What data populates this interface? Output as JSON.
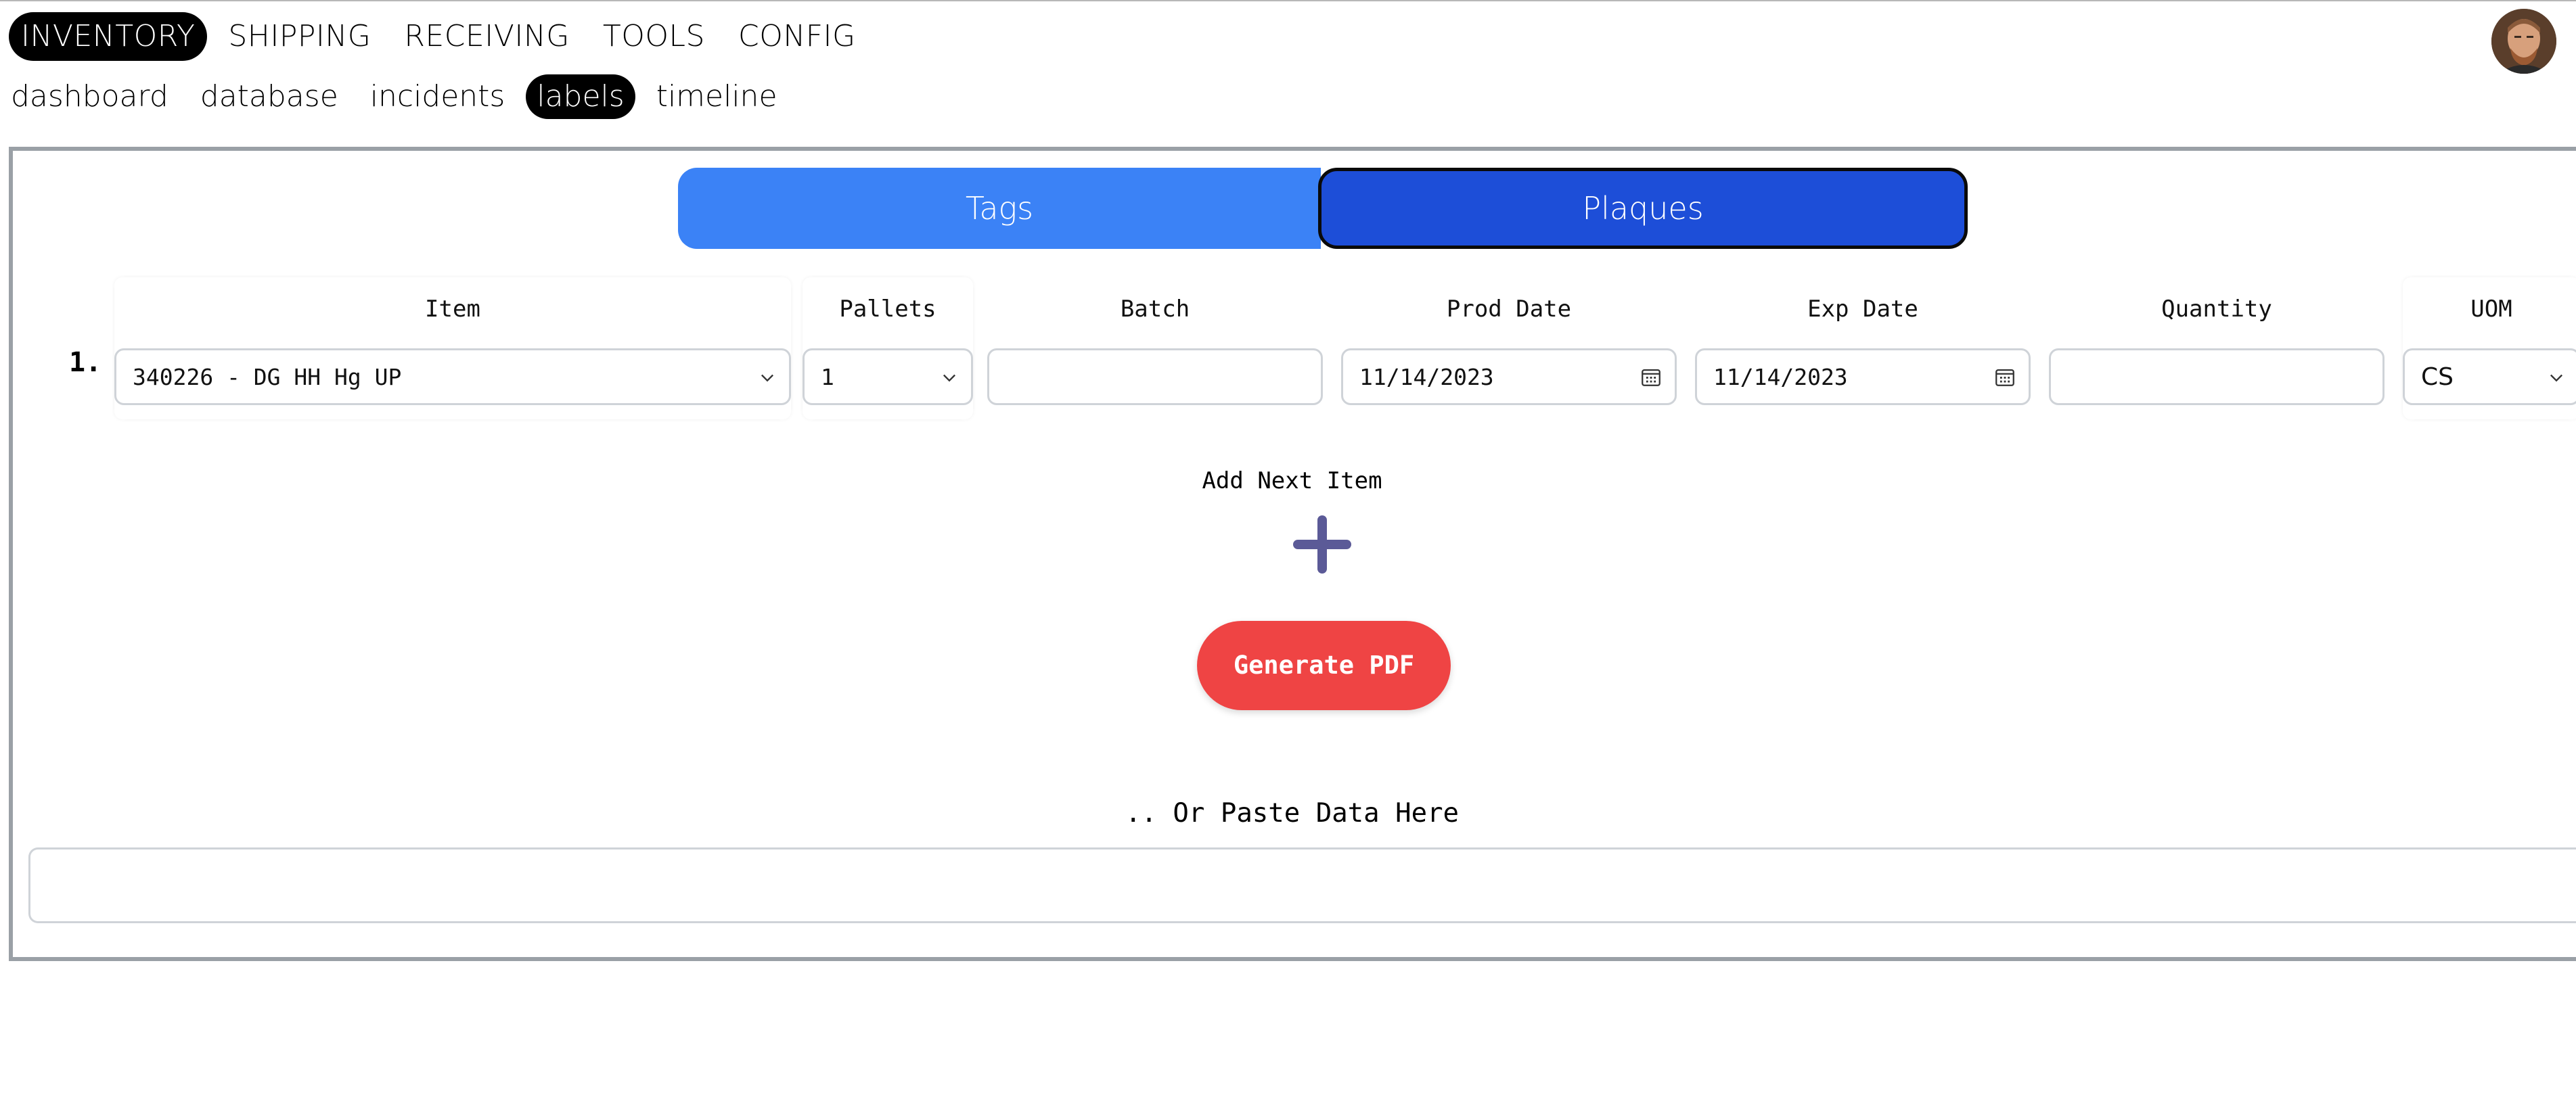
{
  "nav": {
    "primary": [
      {
        "label": "INVENTORY",
        "active": true
      },
      {
        "label": "SHIPPING",
        "active": false
      },
      {
        "label": "RECEIVING",
        "active": false
      },
      {
        "label": "TOOLS",
        "active": false
      },
      {
        "label": "CONFIG",
        "active": false
      }
    ],
    "secondary": [
      {
        "label": "dashboard",
        "active": false
      },
      {
        "label": "database",
        "active": false
      },
      {
        "label": "incidents",
        "active": false
      },
      {
        "label": "labels",
        "active": true
      },
      {
        "label": "timeline",
        "active": false
      }
    ]
  },
  "toggle": {
    "tags": "Tags",
    "plaques": "Plaques",
    "selected": "Plaques"
  },
  "form": {
    "row_number": "1.",
    "columns": {
      "item": "Item",
      "pallets": "Pallets",
      "batch": "Batch",
      "prod_date": "Prod Date",
      "exp_date": "Exp Date",
      "quantity": "Quantity",
      "uom": "UOM"
    },
    "row": {
      "item": "340226 - DG HH Hg UP",
      "pallets": "1",
      "batch": "",
      "prod_date": "11/14/2023",
      "exp_date": "11/14/2023",
      "quantity": "",
      "uom": "CS"
    }
  },
  "add_next_label": "Add Next Item",
  "generate_button": "Generate PDF",
  "paste_label": ".. Or Paste Data Here",
  "colors": {
    "tags_bg": "#3b82f6",
    "plaques_bg": "#1d4ed8",
    "generate_bg": "#ef4444",
    "plus_color": "#5b5a97",
    "nav_active_bg": "#000000"
  },
  "icons": {
    "add": "plus-icon",
    "dropdown": "chevron-down-icon",
    "date": "calendar-icon"
  }
}
